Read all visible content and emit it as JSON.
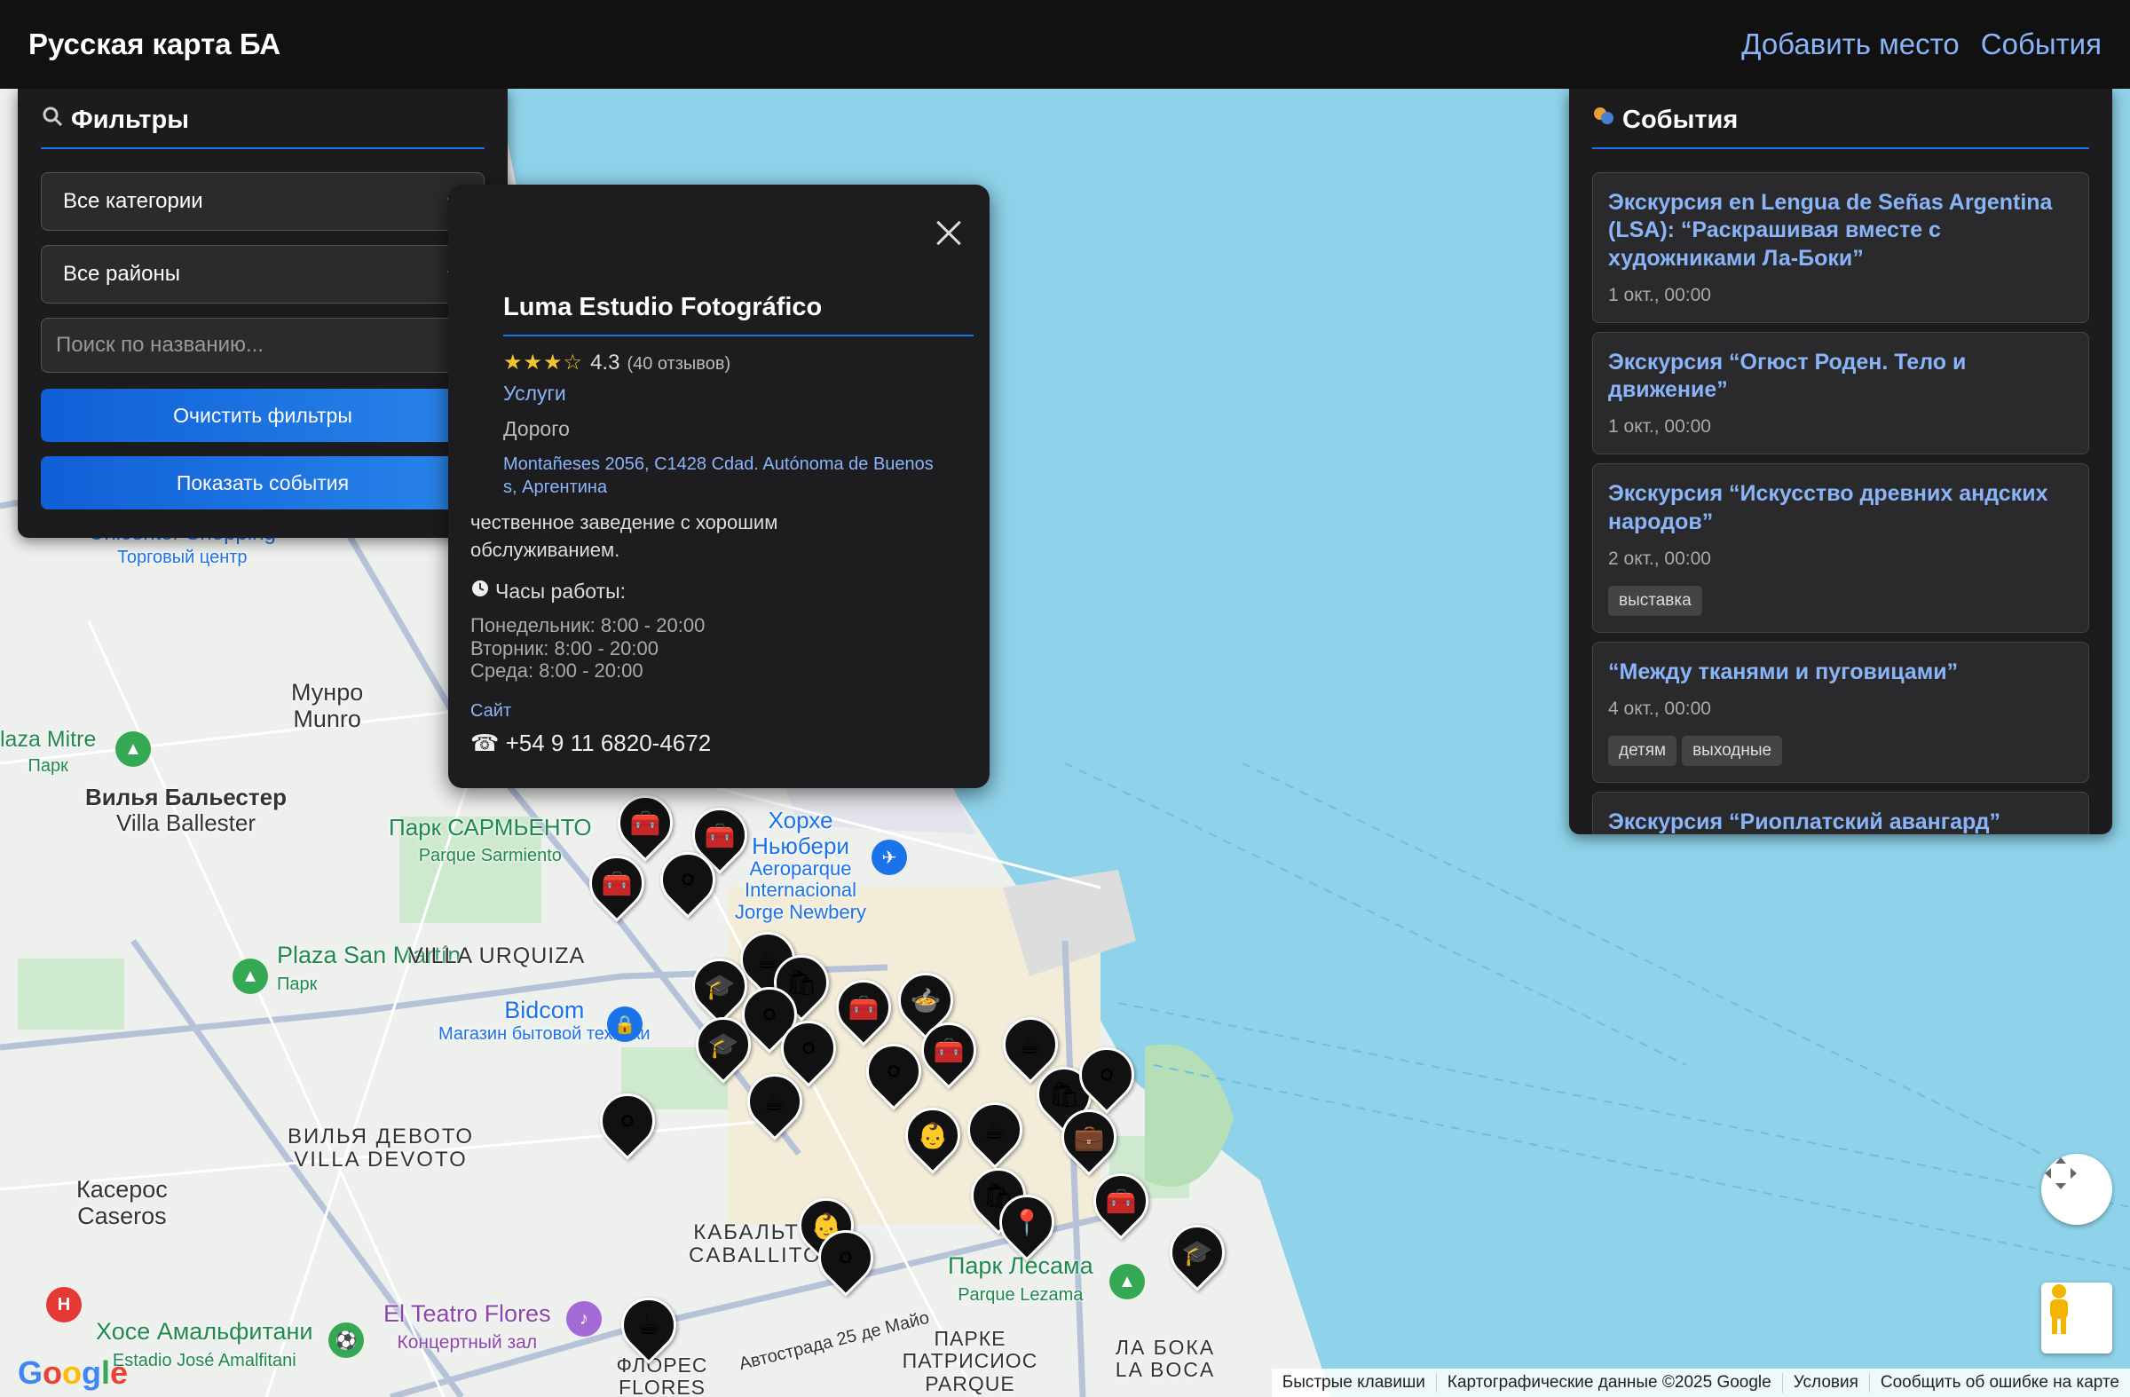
{
  "header": {
    "brand": "Русская карта БА",
    "nav": [
      "Добавить место",
      "События"
    ]
  },
  "filters": {
    "title": "Фильтры",
    "category_select": "Все категории",
    "district_select": "Все районы",
    "search_placeholder": "Поиск по названию...",
    "clear_button": "Очистить фильтры",
    "events_button": "Показать события"
  },
  "infowindow": {
    "title": "Luma Estudio Fotográfico",
    "rating": "4.3",
    "rating_stars": "★★★☆",
    "review_count": "(40 отзывов)",
    "category": "Услуги",
    "price": "Дорого",
    "address_line1": "Montañeses 2056, C1428 Cdad. Autónoma de Buenos",
    "address_line2": "s, Аргентина",
    "description_line1": "чественное заведение с хорошим",
    "description_line2": "обслуживанием.",
    "hours_title": "Часы работы:",
    "hours": [
      "Понедельник: 8:00 - 20:00",
      "Вторник: 8:00 - 20:00",
      "Среда: 8:00 - 20:00"
    ],
    "site_link": "Сайт",
    "phone": "☎ +54 9 11 6820-4672"
  },
  "events": {
    "title": "События",
    "items": [
      {
        "title": "Экскурсия en Lengua de Señas Argentina (LSA): “Раскрашивая вместе с художниками Ла-Боки”",
        "date": "1 окт., 00:00",
        "tags": []
      },
      {
        "title": "Экскурсия “Огюст Роден. Тело и движение”",
        "date": "1 окт., 00:00",
        "tags": []
      },
      {
        "title": "Экскурсия “Искусство древних андских народов”",
        "date": "2 окт., 00:00",
        "tags": [
          "выставка"
        ]
      },
      {
        "title": "“Между тканями и пуговицами”",
        "date": "4 окт., 00:00",
        "tags": [
          "детям",
          "выходные"
        ]
      },
      {
        "title": "Экскурсия “Риоплатский авангард”",
        "date": "",
        "tags": []
      }
    ]
  },
  "map_labels": {
    "unicenter": "Unicenter Shopping",
    "mall": "Торговый центр",
    "munro_ru": "Мунро",
    "munro": "Munro",
    "plaza_mitre": "laza Mitre",
    "park": "Парк",
    "villa_ballester_ru": "Вилья Бальестер",
    "villa_ballester": "Villa Ballester",
    "park_sarmiento_ru": "Парк САРМЬЕНТО",
    "parque_sarmiento": "Parque Sarmiento",
    "newbery_ru": "Хорхе Ньюбери",
    "aeroparque": "Aeroparque Internacional Jorge Newbery",
    "plaza_san_martin": "Plaza San Martín",
    "villa_urquiza": "VILLA URQUIZA",
    "bidcom": "Bidcom",
    "bidcom_sub": "Магазин бытовой техники",
    "villa_devoto_ru": "ВИЛЬЯ ДЕВОТО",
    "villa_devoto": "VILLA DEVOTO",
    "caseros_ru": "Касерос",
    "caseros": "Caseros",
    "caballito_ru": "КАБАЛЬТО",
    "caballito": "CABALLITO",
    "lezama_ru": "Парк Лесама",
    "lezama": "Parque Lezama",
    "amalfitani_ru": "Хосе Амальфитани",
    "amalfitani": "Estadio José Amalfitani",
    "teatro_flores": "El Teatro Flores",
    "concert": "Концертный зал",
    "avenue": "Автострада 25 де Майо",
    "flores": "ФЛОРЕС FLORES",
    "patricios": "ПАРКЕ ПАТРИСИОС PARQUE",
    "la_boca": "ЛА БОКА LA BOCA"
  },
  "attribution": [
    "Быстрые клавиши",
    "Картографические данные ©2025 Google",
    "Условия",
    "Сообщить об ошибке на карте"
  ],
  "google": "Google",
  "colors": {
    "accent": "#1a73e8",
    "link": "#8ab4f8",
    "panel": "#1c1c1e",
    "water": "#8fd3ea"
  },
  "icons": [
    "search-icon",
    "theater-icon",
    "close-icon",
    "clock-icon",
    "phone-icon",
    "fullscreen-icon",
    "pegman-icon"
  ]
}
